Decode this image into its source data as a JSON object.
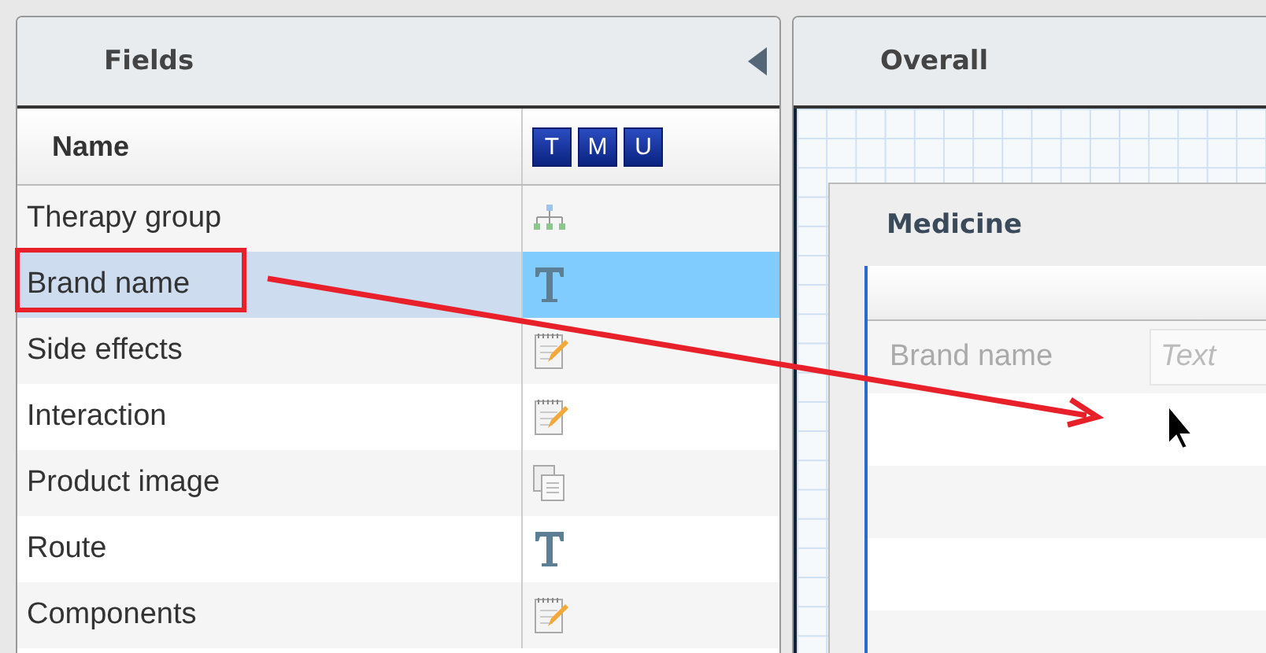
{
  "fields_panel": {
    "title": "Fields",
    "table": {
      "columns": [
        "Name"
      ],
      "type_buttons": [
        "T",
        "M",
        "U"
      ],
      "rows": [
        {
          "name": "Therapy group",
          "kind": "hierarchy",
          "selected": false
        },
        {
          "name": "Brand name",
          "kind": "text",
          "selected": true
        },
        {
          "name": "Side effects",
          "kind": "notepad",
          "selected": false
        },
        {
          "name": "Interaction",
          "kind": "notepad",
          "selected": false
        },
        {
          "name": "Product image",
          "kind": "copy",
          "selected": false
        },
        {
          "name": "Route",
          "kind": "text",
          "selected": false
        },
        {
          "name": "Components",
          "kind": "notepad",
          "selected": false
        }
      ]
    }
  },
  "overall_panel": {
    "title": "Overall",
    "form": {
      "title": "Medicine",
      "rows": [
        {
          "label": "Brand name",
          "placeholder": "Text"
        }
      ]
    }
  }
}
